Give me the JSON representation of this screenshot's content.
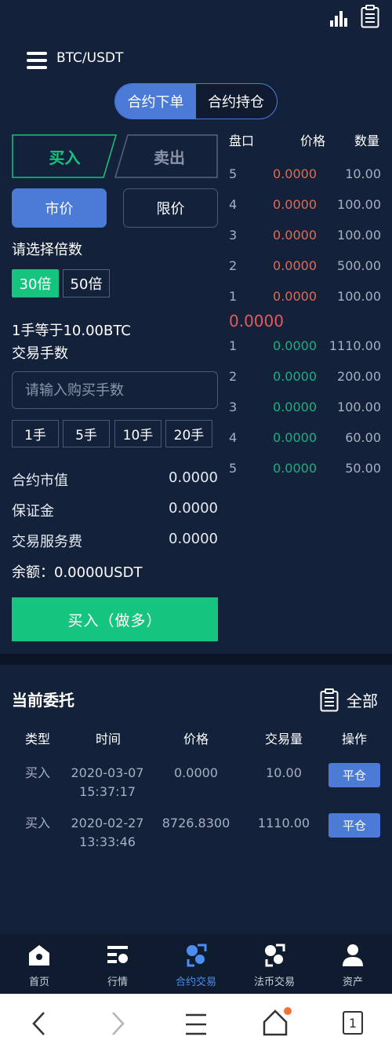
{
  "header": {
    "pair": "BTC/USDT",
    "menu_icon": "hamburger-menu-icon",
    "chart_icon": "bar-chart-icon",
    "clipboard_icon": "clipboard-icon"
  },
  "segment": {
    "place_order": "合约下单",
    "positions": "合约持仓"
  },
  "trade": {
    "buy_tab": "买入",
    "sell_tab": "卖出",
    "market": "市价",
    "limit": "限价",
    "leverage_label": "请选择倍数",
    "leverages": [
      "30倍",
      "50倍"
    ],
    "lot_info": "1手等于10.00BTC",
    "lots_label": "交易手数",
    "lots_placeholder": "请输入购买手数",
    "quick_lots": [
      "1手",
      "5手",
      "10手",
      "20手"
    ],
    "contract_value_label": "合约市值",
    "contract_value": "0.0000",
    "margin_label": "保证金",
    "margin": "0.0000",
    "fee_label": "交易服务费",
    "fee": "0.0000",
    "balance": "余额：0.0000USDT",
    "submit": "买入（做多）"
  },
  "orderbook": {
    "headers": [
      "盘口",
      "价格",
      "数量"
    ],
    "asks": [
      {
        "level": "5",
        "price": "0.0000",
        "qty": "10.00"
      },
      {
        "level": "4",
        "price": "0.0000",
        "qty": "100.00"
      },
      {
        "level": "3",
        "price": "0.0000",
        "qty": "100.00"
      },
      {
        "level": "2",
        "price": "0.0000",
        "qty": "500.00"
      },
      {
        "level": "1",
        "price": "0.0000",
        "qty": "100.00"
      }
    ],
    "last_price": "0.0000",
    "bids": [
      {
        "level": "1",
        "price": "0.0000",
        "qty": "1110.00"
      },
      {
        "level": "2",
        "price": "0.0000",
        "qty": "200.00"
      },
      {
        "level": "3",
        "price": "0.0000",
        "qty": "100.00"
      },
      {
        "level": "4",
        "price": "0.0000",
        "qty": "60.00"
      },
      {
        "level": "5",
        "price": "0.0000",
        "qty": "50.00"
      }
    ]
  },
  "orders": {
    "title": "当前委托",
    "all": "全部",
    "columns": [
      "类型",
      "时间",
      "价格",
      "交易量",
      "操作"
    ],
    "rows": [
      {
        "type": "买入",
        "date": "2020-03-07",
        "time": "15:37:17",
        "price": "0.0000",
        "volume": "10.00",
        "action": "平仓"
      },
      {
        "type": "买入",
        "date": "2020-02-27",
        "time": "13:33:46",
        "price": "8726.8300",
        "volume": "1110.00",
        "action": "平仓"
      }
    ]
  },
  "nav": [
    {
      "label": "首页",
      "icon": "home-icon"
    },
    {
      "label": "行情",
      "icon": "market-list-icon"
    },
    {
      "label": "合约交易",
      "icon": "contract-trade-icon",
      "active": true
    },
    {
      "label": "法币交易",
      "icon": "fiat-trade-icon"
    },
    {
      "label": "资产",
      "icon": "user-icon"
    }
  ],
  "browser": {
    "tab_count": "1"
  },
  "colors": {
    "bg": "#14213a",
    "accent": "#4b7bd6",
    "green": "#15c47e",
    "red": "#e5694a"
  }
}
